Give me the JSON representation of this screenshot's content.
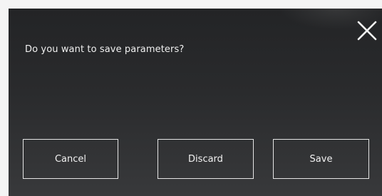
{
  "dialog": {
    "message": "Do you want to save parameters?",
    "close_icon": "close-icon",
    "buttons": {
      "cancel": "Cancel",
      "discard": "Discard",
      "save": "Save"
    }
  },
  "colors": {
    "dialog_background": "#2a2b2d",
    "text": "#f0f0f0",
    "button_border": "#e6e6e6"
  }
}
